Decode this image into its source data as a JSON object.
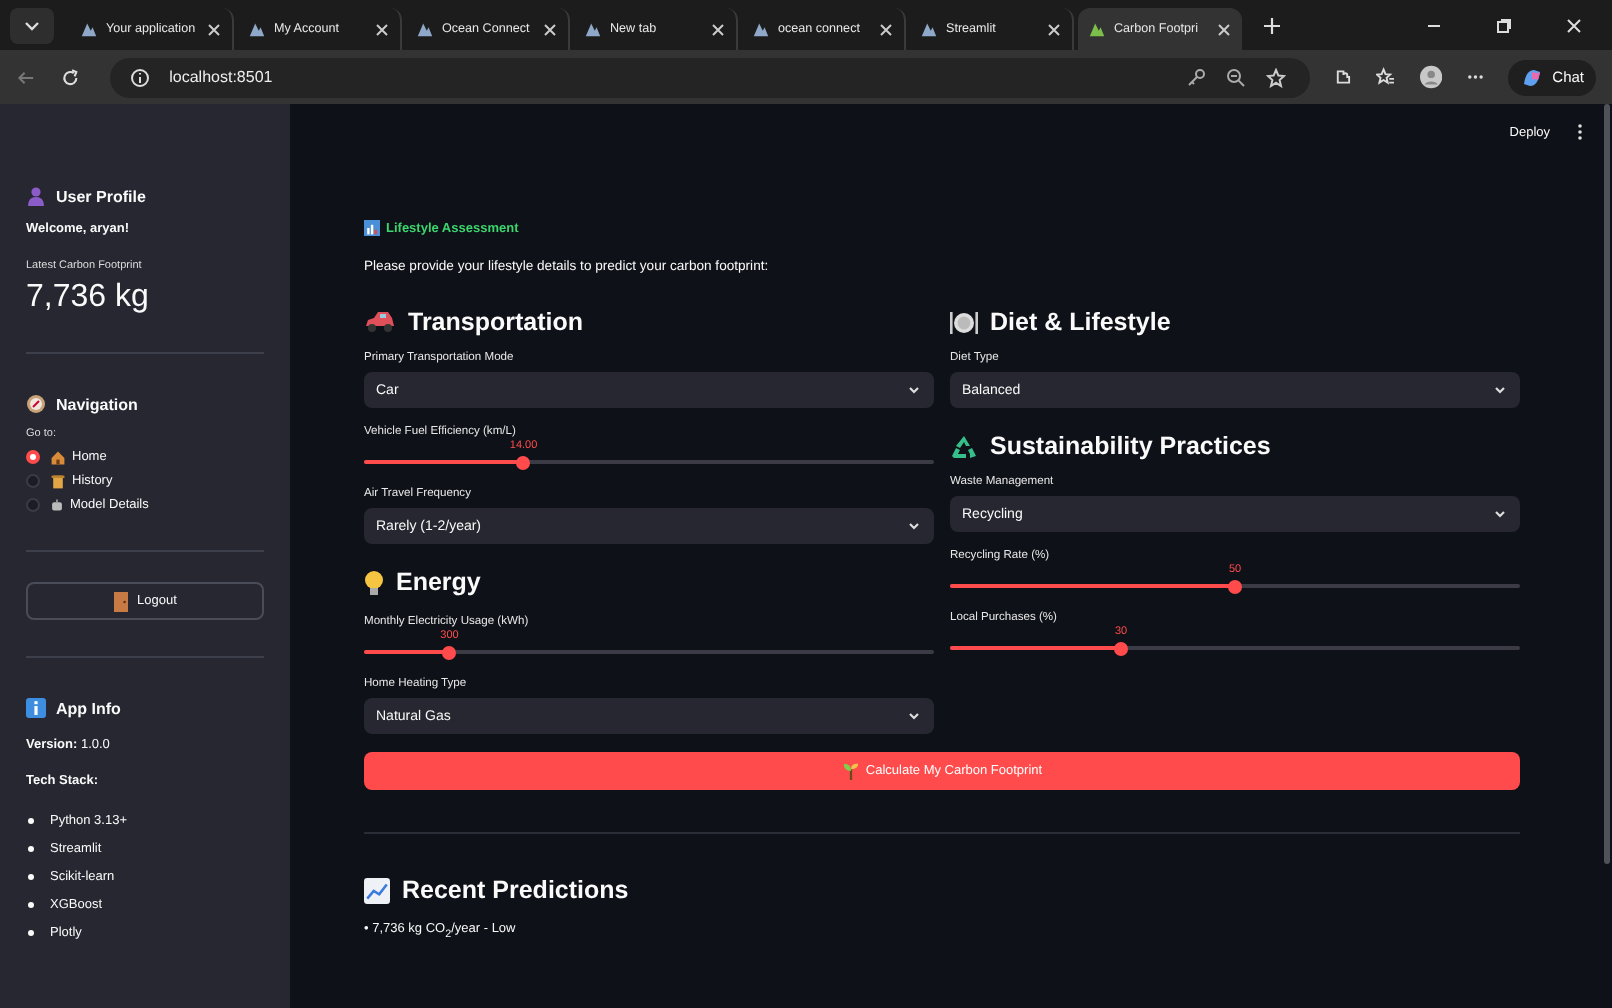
{
  "browser": {
    "tabs": [
      {
        "title": "Your application",
        "selected": false
      },
      {
        "title": "My Account",
        "selected": false
      },
      {
        "title": "Ocean Connect",
        "selected": false
      },
      {
        "title": "New tab",
        "selected": false
      },
      {
        "title": "ocean connect",
        "selected": false
      },
      {
        "title": "Streamlit",
        "selected": false
      },
      {
        "title": "Carbon Footpri",
        "selected": true
      }
    ],
    "address": "localhost:8501",
    "chat_button": "Chat"
  },
  "header": {
    "deploy": "Deploy"
  },
  "sidebar": {
    "profile_title": "User Profile",
    "welcome": "Welcome, aryan!",
    "metric_label": "Latest Carbon Footprint",
    "metric_value": "7,736 kg",
    "nav_title": "Navigation",
    "nav_label": "Go to:",
    "nav_options": [
      {
        "label": "Home",
        "selected": true
      },
      {
        "label": "History",
        "selected": false
      },
      {
        "label": "Model Details",
        "selected": false
      }
    ],
    "logout": "Logout",
    "info_title": "App Info",
    "version": "**Version:** 1.0.0",
    "tech_title": "Tech Stack:",
    "tech_stack": [
      "Python 3.13+",
      "Streamlit",
      "Scikit-learn",
      "XGBoost",
      "Plotly"
    ]
  },
  "main": {
    "section_label": "Lifestyle Assessment",
    "intro": "Please provide your lifestyle details to predict your carbon footprint:",
    "columns": [
      {
        "sections": [
          {
            "title": "Transportation",
            "fields": [
              {
                "kind": "select",
                "label": "Primary Transportation Mode",
                "value": "Car"
              },
              {
                "kind": "slider",
                "label": "Vehicle Fuel Efficiency (km/L)",
                "reading": "14.00",
                "level": 0.28
              },
              {
                "kind": "select",
                "label": "Air Travel Frequency",
                "value": "Rarely (1-2/year)"
              }
            ]
          },
          {
            "title": "Energy",
            "fields": [
              {
                "kind": "slider",
                "label": "Monthly Electricity Usage (kWh)",
                "reading": "300",
                "level": 0.15
              },
              {
                "kind": "select",
                "label": "Home Heating Type",
                "value": "Natural Gas"
              }
            ]
          }
        ]
      },
      {
        "sections": [
          {
            "title": "Diet & Lifestyle",
            "fields": [
              {
                "kind": "select",
                "label": "Diet Type",
                "value": "Balanced"
              }
            ]
          },
          {
            "title": "Sustainability Practices",
            "fields": [
              {
                "kind": "select",
                "label": "Waste Management",
                "value": "Recycling"
              },
              {
                "kind": "slider",
                "label": "Recycling Rate (%)",
                "reading": "50",
                "level": 0.5
              },
              {
                "kind": "slider",
                "label": "Local Purchases (%)",
                "reading": "30",
                "level": 0.3
              }
            ]
          }
        ]
      }
    ],
    "submit": "Calculate My Carbon Footprint",
    "recent_title": "Recent Predictions",
    "recent": [
      "• 7,736 kg CO$_{2}$/year - Low"
    ]
  }
}
